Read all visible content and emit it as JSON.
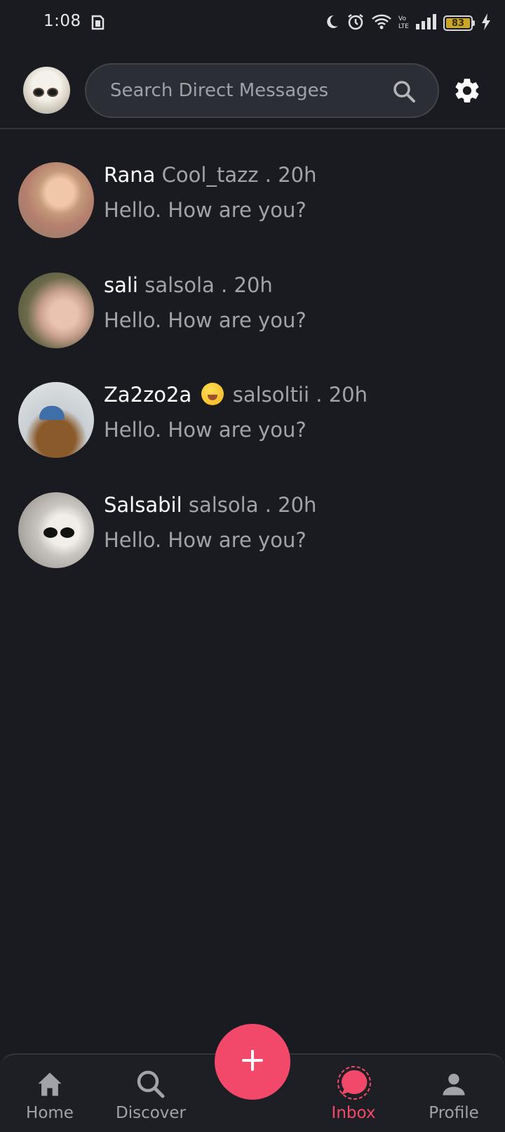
{
  "status_bar": {
    "time": "1:08",
    "battery_level": "83"
  },
  "header": {
    "search_placeholder": "Search Direct Messages"
  },
  "conversations": [
    {
      "name": "Rana",
      "handle": "Cool_tazz . 20h",
      "message": "Hello. How are you?",
      "avatar": "girl-photo"
    },
    {
      "name": "sali",
      "handle": "salsola . 20h",
      "message": "Hello. How are you?",
      "avatar": "girl-photo"
    },
    {
      "name": "Za2zo2a",
      "emoji": "yawning-face-emoji",
      "handle": "salsoltii . 20h",
      "message": "Hello. How are you?",
      "avatar": "dog-photo"
    },
    {
      "name": "Salsabil",
      "handle": "salsola . 20h",
      "message": "Hello. How are you?",
      "avatar": "cat-photo"
    }
  ],
  "bottom_nav": {
    "items": [
      {
        "label": "Home",
        "icon": "home-icon"
      },
      {
        "label": "Discover",
        "icon": "search-icon"
      },
      {
        "label": "Inbox",
        "icon": "chat-bubble-icon",
        "active": true
      },
      {
        "label": "Profile",
        "icon": "person-icon"
      }
    ],
    "fab_icon": "plus-icon"
  },
  "colors": {
    "background": "#1a1b21",
    "accent": "#f2496b",
    "muted_text": "#a2a3a8"
  }
}
